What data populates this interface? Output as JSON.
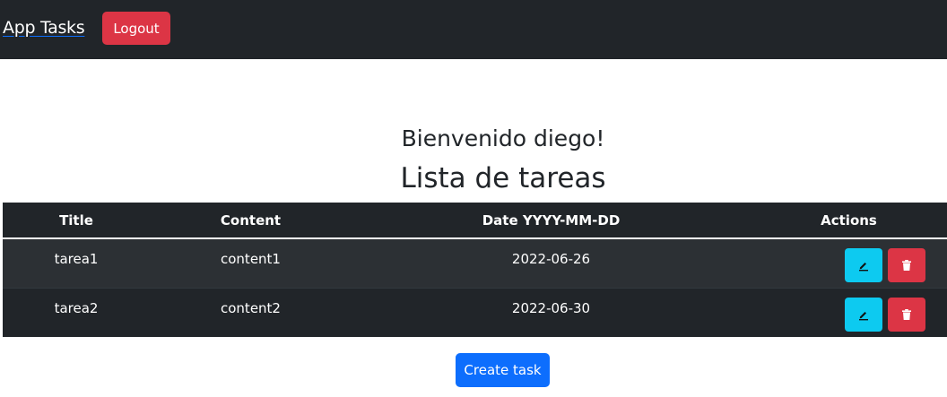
{
  "navbar": {
    "brand": "App Tasks",
    "logout_label": "Logout"
  },
  "main": {
    "welcome": "Bienvenido diego!",
    "list_title": "Lista de tareas",
    "create_label": "Create task"
  },
  "table": {
    "headers": [
      "Title",
      "Content",
      "Date YYYY-MM-DD",
      "Actions"
    ],
    "rows": [
      {
        "title": "tarea1",
        "content": "content1",
        "date": "2022-06-26"
      },
      {
        "title": "tarea2",
        "content": "content2",
        "date": "2022-06-30"
      }
    ],
    "row_actions": [
      "pencil-icon",
      "trash-icon"
    ]
  },
  "colors": {
    "navbar": "#212529",
    "danger": "#dc3545",
    "info": "#0dcaf0",
    "primary": "#0d6efd"
  }
}
